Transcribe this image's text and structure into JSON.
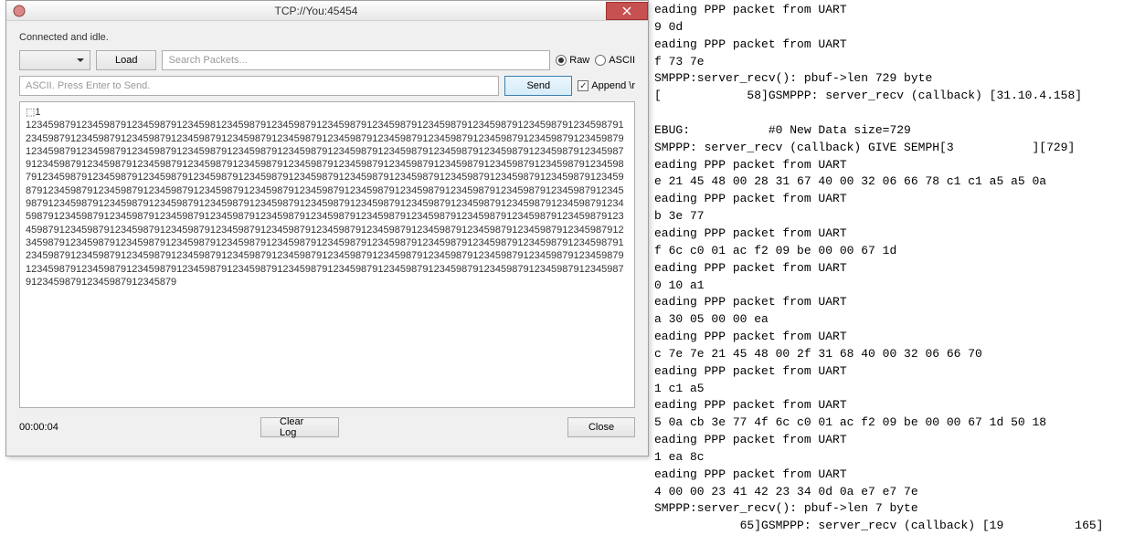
{
  "dialog": {
    "title": "TCP://You:45454",
    "status": "Connected and idle.",
    "load_label": "Load",
    "search_placeholder": "Search Packets...",
    "raw_label": "Raw",
    "ascii_label": "ASCII",
    "ascii_placeholder": "ASCII. Press Enter to Send.",
    "send_label": "Send",
    "append_label": "Append \\r",
    "log_text": "⬚1 123459879123459879123459879123459812345987912345987912345987912345987912345987912345987912345987912345987912345987912345987912345987912345987912345987912345987912345987912345987912345987912345987912345987912345987912345987912345987912345987912345987912345987912345987912345987912345987912345987912345987912345987912345987912345987912345987912345987912345987912345987912345987912345987912345987912345987912345987912345987912345987912345987912345987912345987912345987912345987912345987912345987912345987912345987912345987912345987912345987912345987912345987912345987912345987912345987912345987912345987912345987912345987912345987912345987912345987912345987912345987912345987912345987912345987912345987912345987912345987912345987912345987912345987912345987912345987912345987912345987912345987912345987912345987912345987912345987912345987912345987912345987912345987912345987912345987912345987912345987912345987912345987912345987912345987912345987912345987912345987912345987912345987912345987912345987912345987912345987912345987912345987912345987912345987912345987912345987912345987912345987912345987912345987912345987912345987912345987912345987912345987912345987912345987912345987912345987912345987912345987912345987912345987912345987912345987912345987912345987912345987912345987912345987912345987912345987912345879",
    "timer": "00:00:04",
    "clear_label": "Clear Log",
    "close_label": "Close"
  },
  "console": {
    "lines": [
      "eading PPP packet from UART",
      "9 0d",
      "eading PPP packet from UART",
      "f 73 7e",
      "SMPPP:server_recv(): pbuf->len 729 byte",
      "[            58]GSMPPP: server_recv (callback) [31.10.4.158]",
      "",
      "EBUG:           #0 New Data size=729",
      "SMPPP: server_recv (callback) GIVE SEMPH[3           ][729]",
      "eading PPP packet from UART",
      "e 21 45 48 00 28 31 67 40 00 32 06 66 78 c1 c1 a5 a5 0a",
      "eading PPP packet from UART",
      "b 3e 77",
      "eading PPP packet from UART",
      "f 6c c0 01 ac f2 09 be 00 00 67 1d",
      "eading PPP packet from UART",
      "0 10 a1",
      "eading PPP packet from UART",
      "a 30 05 00 00 ea",
      "eading PPP packet from UART",
      "c 7e 7e 21 45 48 00 2f 31 68 40 00 32 06 66 70",
      "eading PPP packet from UART",
      "1 c1 a5",
      "eading PPP packet from UART",
      "5 0a cb 3e 77 4f 6c c0 01 ac f2 09 be 00 00 67 1d 50 18",
      "eading PPP packet from UART",
      "1 ea 8c",
      "eading PPP packet from UART",
      "4 00 00 23 41 42 23 34 0d 0a e7 e7 7e",
      "SMPPP:server_recv(): pbuf->len 7 byte",
      "            65]GSMPPP: server_recv (callback) [19          165]",
      ""
    ]
  }
}
